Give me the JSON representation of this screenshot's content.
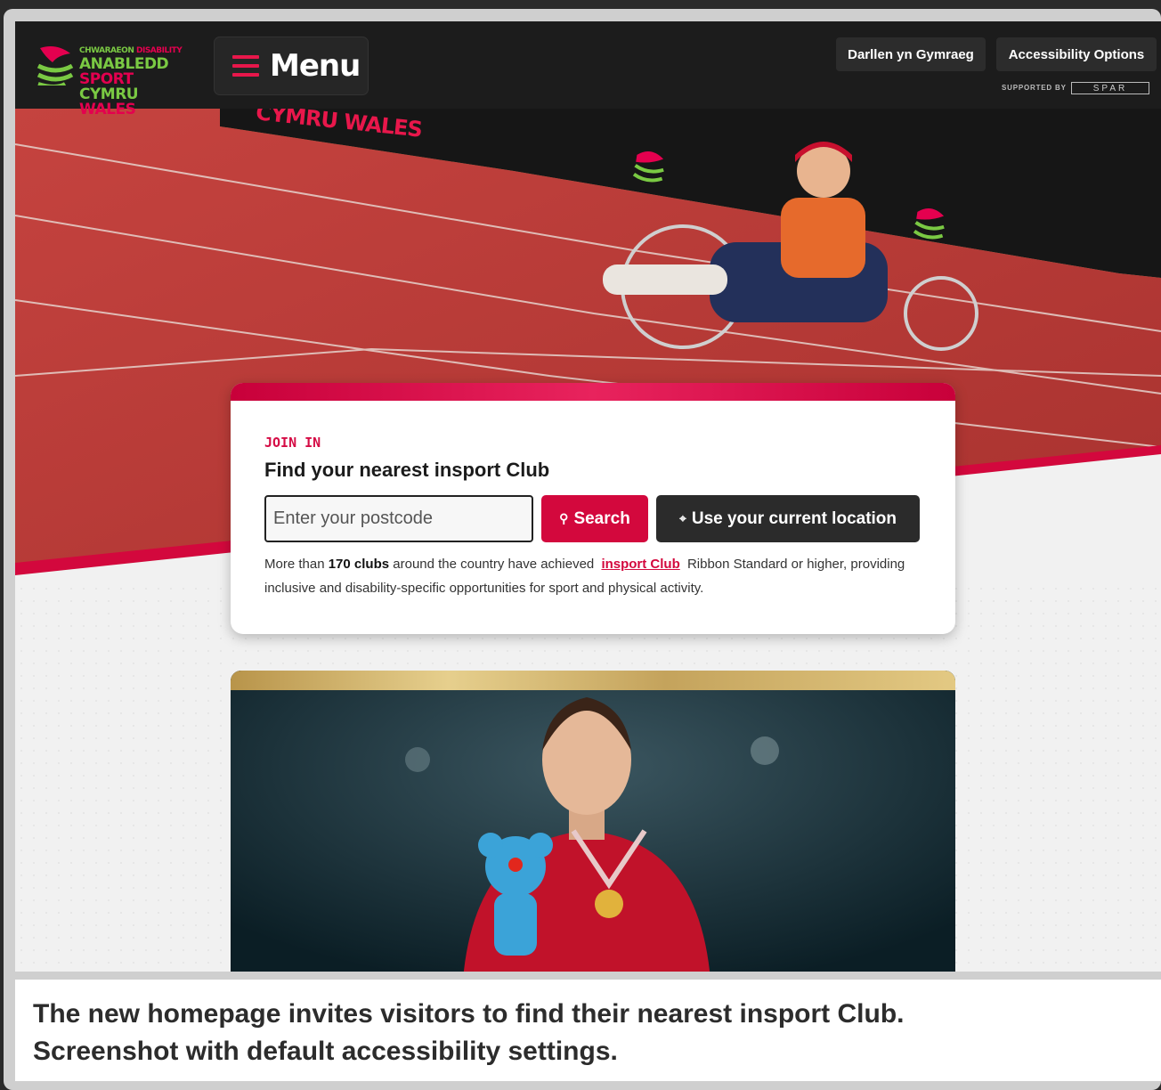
{
  "header": {
    "logo": {
      "line1_welsh": "CHWARAEON",
      "line1_english": "DISABILITY",
      "line2_welsh": "ANABLEDD",
      "line2_english": "SPORT",
      "line3_welsh": "CYMRU",
      "line3_english": "WALES"
    },
    "menu_label": "Menu",
    "welsh_label": "Darllen yn Gymraeg",
    "accessibility_label": "Accessibility Options",
    "supported_by": "SUPPORTED BY",
    "sponsor": "SPAR"
  },
  "hero": {
    "banner_text": "CYMRU WALES"
  },
  "search_card": {
    "eyebrow": "JOIN IN",
    "title": "Find your nearest insport Club",
    "postcode_placeholder": "Enter your postcode",
    "search_label": "Search",
    "location_label": "Use your current location",
    "desc_before": "More than",
    "desc_bold": "170 clubs",
    "desc_middle": "around the country have achieved",
    "desc_link": "insport Club",
    "desc_after": "Ribbon Standard or higher, providing inclusive and disability-specific opportunities for sport and physical activity."
  },
  "caption": {
    "line1": "The new homepage invites visitors to find their nearest insport Club.",
    "line2": "Screenshot with default accessibility settings."
  },
  "colors": {
    "brand_red": "#d3083d",
    "brand_green": "#7ac943",
    "header_bg": "#1c1c1c"
  }
}
